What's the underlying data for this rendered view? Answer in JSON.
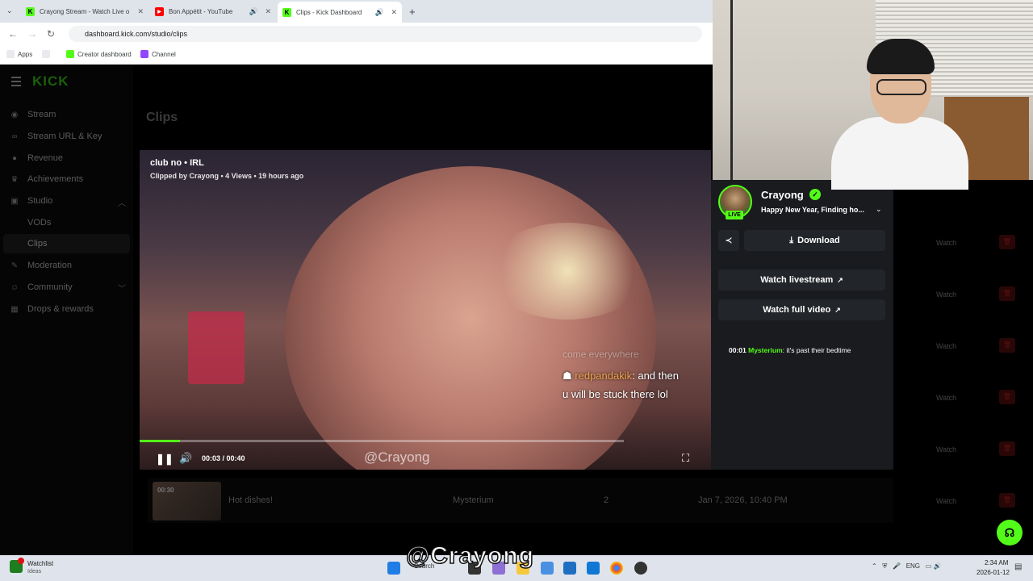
{
  "browser": {
    "tabs": [
      {
        "label": "Crayong Stream - Watch Live o"
      },
      {
        "label": "Bon Appétit - YouTube"
      },
      {
        "label": "Clips - Kick Dashboard"
      }
    ],
    "url": "dashboard.kick.com/studio/clips",
    "bookmarks": [
      {
        "label": "Apps"
      },
      {
        "label": "Creator dashboard"
      },
      {
        "label": "Channel"
      }
    ]
  },
  "sidebar": {
    "logo": "KICK",
    "items": [
      {
        "label": "Stream"
      },
      {
        "label": "Stream URL & Key"
      },
      {
        "label": "Revenue"
      },
      {
        "label": "Achievements"
      },
      {
        "label": "Studio"
      },
      {
        "label": "VODs"
      },
      {
        "label": "Clips"
      },
      {
        "label": "Moderation"
      },
      {
        "label": "Community"
      },
      {
        "label": "Drops & rewards"
      }
    ]
  },
  "page": {
    "title": "Clips"
  },
  "player": {
    "title": "club no • IRL",
    "meta": "Clipped by Crayong • 4 Views • 19 hours ago",
    "chat_user": "redpandakik",
    "chat_text1": ": and then",
    "chat_text2": "u will be stuck there lol",
    "chat_faded": "come everywhere",
    "current_time": "00:03",
    "duration": "00:40",
    "watermark": "@Crayong",
    "progress": 0.0825
  },
  "panel": {
    "streamer": "Crayong",
    "live": "LIVE",
    "stream_title": "Happy New Year, Finding ho...",
    "download": "Download",
    "watch_livestream": "Watch livestream",
    "watch_full_video": "Watch full video",
    "chat": {
      "time": "00:01",
      "user": "Mysterium",
      "message": ": it's past their bedtime"
    }
  },
  "table": {
    "watch_label": "Watch",
    "row": {
      "duration": "00:30",
      "title": "Hot dishes!",
      "clipper": "Mysterium",
      "views": "2",
      "date": "Jan 7, 2026, 10:40 PM"
    }
  },
  "subtitle": "@Crayong",
  "taskbar": {
    "watchlist": "Watchlist",
    "watchlist_sub": "Ideas",
    "search": "Search",
    "lang": "ENG",
    "time": "2:34 AM",
    "date": "2026-01-12"
  },
  "colors": {
    "accent": "#53fc18"
  }
}
